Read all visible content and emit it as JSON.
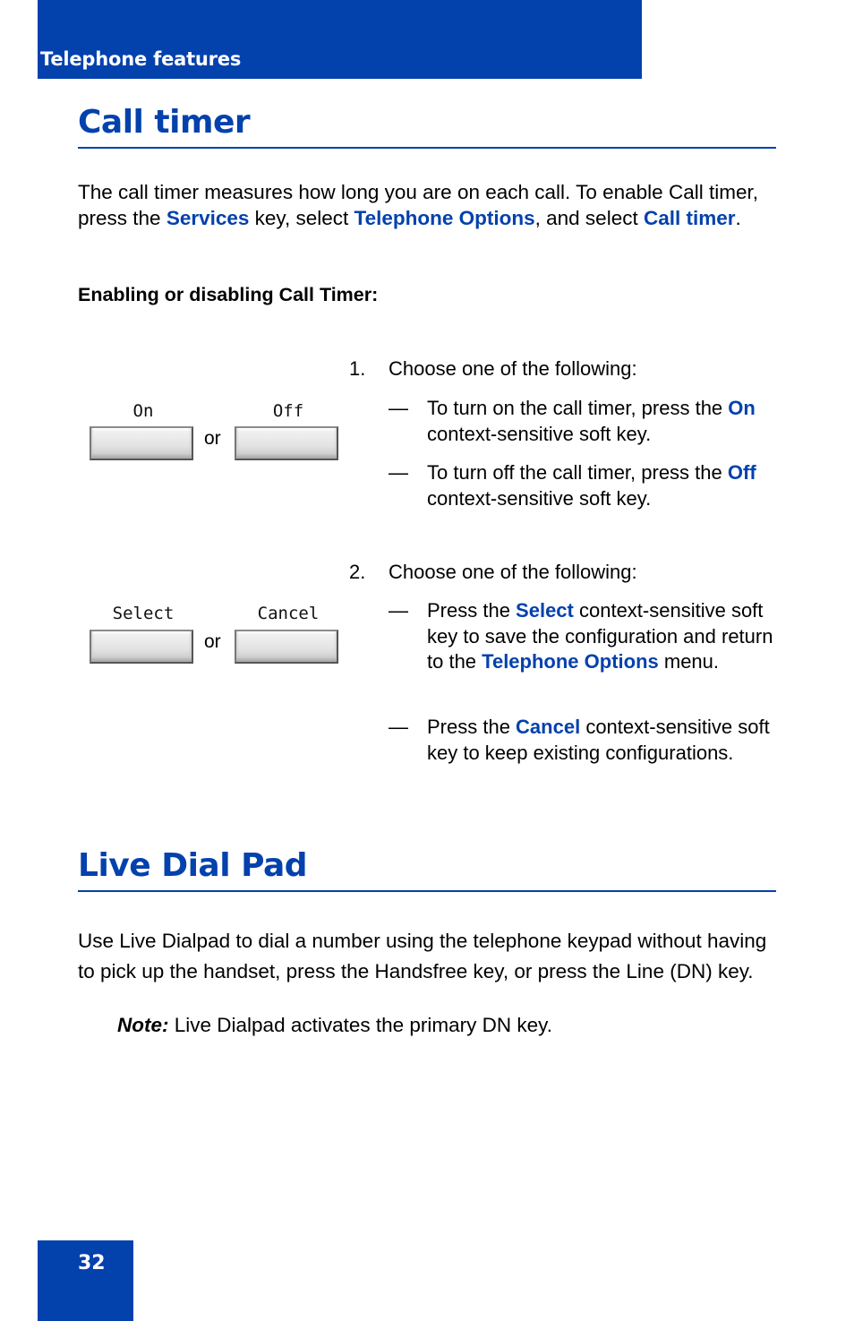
{
  "header": {
    "section_label": "Telephone features"
  },
  "call_timer": {
    "title": "Call timer",
    "intro": {
      "t1": "The call timer measures how long you are on each call. To enable Call timer, press the ",
      "services": "Services",
      "t2": " key, select ",
      "telephone_options": "Telephone Options",
      "t3": ", and select ",
      "call_timer": "Call timer",
      "t4": "."
    },
    "subheading": "Enabling or disabling Call Timer:",
    "steps": [
      {
        "number": "1.",
        "text": "Choose one of the following:",
        "softkeys": {
          "left_label": "On",
          "or": "or",
          "right_label": "Off"
        },
        "bullets": [
          {
            "dash": "—",
            "pre": "To turn on the call timer, press the ",
            "key": "On",
            "post": " context-sensitive soft key."
          },
          {
            "dash": "—",
            "pre": "To turn off the call timer, press the ",
            "key": "Off",
            "post": " context-sensitive soft key."
          }
        ]
      },
      {
        "number": "2.",
        "text": "Choose one of the following:",
        "softkeys": {
          "left_label": "Select",
          "or": "or",
          "right_label": "Cancel"
        },
        "bullets": [
          {
            "dash": "—",
            "pre": "Press the ",
            "key": "Select",
            "mid": " context-sensitive soft key to save the configuration and return to the ",
            "key2": "Telephone Options",
            "post": " menu."
          },
          {
            "dash": "—",
            "pre": "Press the ",
            "key": "Cancel",
            "post": " context-sensitive soft key to keep existing configurations."
          }
        ]
      }
    ]
  },
  "live_dial_pad": {
    "title": "Live Dial Pad",
    "body": "Use Live Dialpad to dial a number using the telephone keypad without having to pick up the handset, press the Handsfree key, or press the Line (DN) key.",
    "note_label": "Note:",
    "note_text": " Live Dialpad activates the primary DN key."
  },
  "footer": {
    "page_number": "32"
  },
  "colors": {
    "brand_blue": "#0341ad"
  }
}
